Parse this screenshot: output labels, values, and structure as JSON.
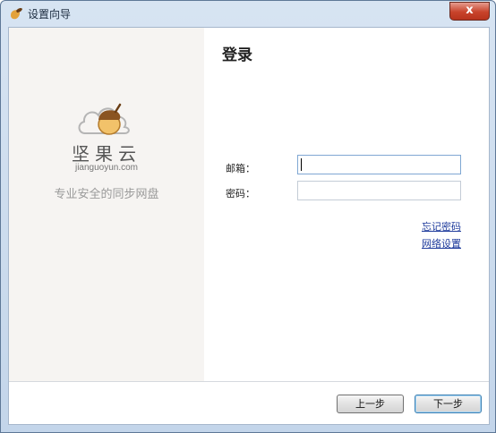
{
  "window": {
    "title": "设置向导",
    "close_label": "x"
  },
  "sidebar": {
    "brand_name": "坚果云",
    "brand_url": "jianguoyun.com",
    "slogan": "专业安全的同步网盘"
  },
  "main": {
    "title": "登录",
    "email_label": "邮箱：",
    "email_value": "",
    "password_label": "密码：",
    "password_value": "",
    "forgot_password_link": "忘记密码",
    "network_settings_link": "网络设置"
  },
  "footer": {
    "back_label": "上一步",
    "next_label": "下一步"
  },
  "colors": {
    "link": "#1e3b9c",
    "nut_light": "#f2c26a",
    "nut_dark": "#8a5421",
    "sidebar_bg": "#f6f4f2"
  }
}
